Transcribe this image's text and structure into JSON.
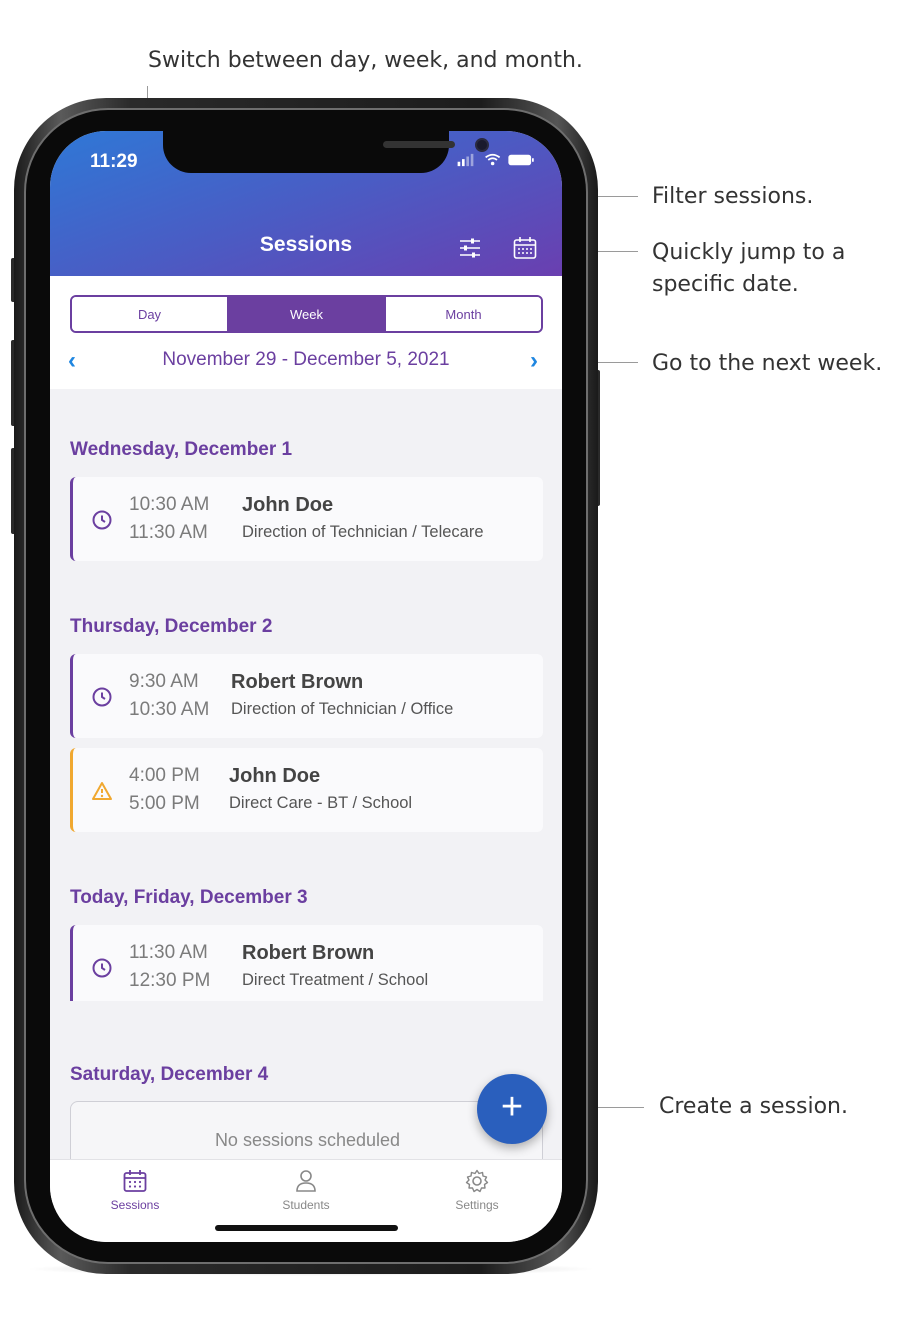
{
  "annotations": {
    "switch": "Switch between day, week, and month.",
    "filter": "Filter sessions.",
    "jump_line1": "Quickly jump to a",
    "jump_line2": "specific date.",
    "next": "Go to the next week.",
    "create": "Create a session."
  },
  "status_bar": {
    "time": "11:29"
  },
  "header": {
    "title": "Sessions",
    "filter_icon": "sliders-icon",
    "calendar_icon": "calendar-icon"
  },
  "view_switcher": {
    "options": [
      "Day",
      "Week",
      "Month"
    ],
    "selected": "Week"
  },
  "date_range": {
    "label": "November 29 - December 5, 2021",
    "prev_icon": "chevron-left-icon",
    "next_icon": "chevron-right-icon"
  },
  "days": [
    {
      "title": "Wednesday, December 1",
      "sessions": [
        {
          "start": "10:30 AM",
          "end": "11:30 AM",
          "name": "John Doe",
          "detail": "Direction of Technician / Telecare",
          "icon": "clock-icon",
          "status_color": "#6b3fa0"
        }
      ]
    },
    {
      "title": "Thursday, December 2",
      "sessions": [
        {
          "start": "9:30 AM",
          "end": "10:30 AM",
          "name": "Robert Brown",
          "detail": "Direction of Technician / Office",
          "icon": "clock-icon",
          "status_color": "#6b3fa0"
        },
        {
          "start": "4:00 PM",
          "end": "5:00 PM",
          "name": "John Doe",
          "detail": "Direct Care - BT / School",
          "icon": "warning-icon",
          "status_color": "#f0a830"
        }
      ]
    },
    {
      "title": "Today, Friday, December 3",
      "sessions": [
        {
          "start": "11:30 AM",
          "end": "12:30 PM",
          "name": "Robert Brown",
          "detail": "Direct Treatment / School",
          "icon": "clock-icon",
          "status_color": "#6b3fa0"
        }
      ]
    },
    {
      "title": "Saturday, December 4",
      "empty_text": "No sessions scheduled"
    }
  ],
  "fab": {
    "label": "+",
    "icon": "plus-icon"
  },
  "tabs": [
    {
      "label": "Sessions",
      "icon": "calendar-icon",
      "active": true
    },
    {
      "label": "Students",
      "icon": "person-icon",
      "active": false
    },
    {
      "label": "Settings",
      "icon": "gear-icon",
      "active": false
    }
  ],
  "colors": {
    "accent": "#6b3fa0",
    "link": "#1f86e0",
    "warning": "#f0a830",
    "fab": "#2a5fbd"
  }
}
